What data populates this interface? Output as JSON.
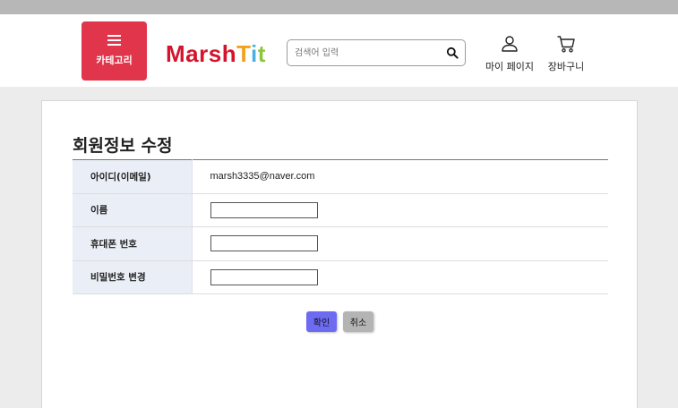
{
  "header": {
    "category_label": "카테고리",
    "logo": {
      "part1": "Marsh",
      "part2": "T",
      "part3": "i",
      "part4": "t"
    },
    "search": {
      "placeholder": "검색어 입력",
      "value": ""
    },
    "mypage_label": "마이 페이지",
    "cart_label": "장바구니"
  },
  "main": {
    "title": "회원정보 수정",
    "rows": [
      {
        "label": "아이디(이메일)",
        "value": "marsh3335@naver.com"
      },
      {
        "label": "이름",
        "value": ""
      },
      {
        "label": "휴대폰 번호",
        "value": ""
      },
      {
        "label": "비밀번호 변경",
        "value": ""
      }
    ],
    "confirm_label": "확인",
    "cancel_label": "취소"
  },
  "colors": {
    "category_button": "#e0354a",
    "confirm_button": "#6c6bf2",
    "cancel_button": "#b4b4b4",
    "label_cell_bg": "#eaeef6"
  },
  "icons": {
    "menu": "hamburger-icon",
    "search": "search-icon",
    "mypage": "user-icon",
    "cart": "cart-icon"
  }
}
